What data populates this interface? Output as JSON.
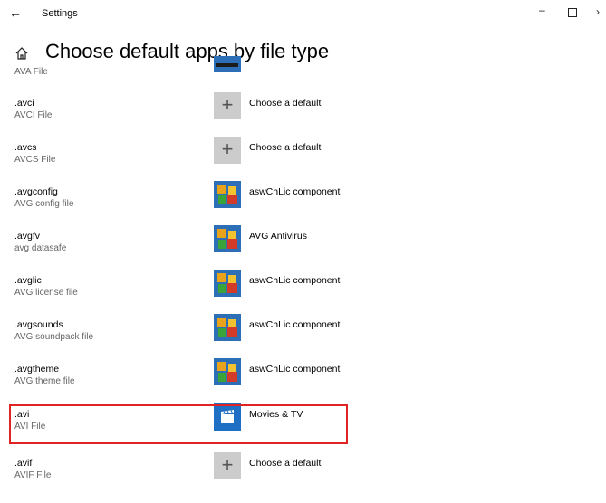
{
  "window": {
    "title": "Settings"
  },
  "header": {
    "title": "Choose default apps by file type"
  },
  "partial_row": {
    "description": "AVA File"
  },
  "rows": [
    {
      "ext": ".avci",
      "desc": "AVCI File",
      "app": "Choose a default",
      "icon": "plus-icon"
    },
    {
      "ext": ".avcs",
      "desc": "AVCS File",
      "app": "Choose a default",
      "icon": "plus-icon"
    },
    {
      "ext": ".avgconfig",
      "desc": "AVG config file",
      "app": "aswChLic component",
      "icon": "avg-icon"
    },
    {
      "ext": ".avgfv",
      "desc": "avg datasafe",
      "app": "AVG Antivirus",
      "icon": "avg-icon"
    },
    {
      "ext": ".avglic",
      "desc": "AVG license file",
      "app": "aswChLic component",
      "icon": "avg-icon"
    },
    {
      "ext": ".avgsounds",
      "desc": "AVG soundpack file",
      "app": "aswChLic component",
      "icon": "avg-icon"
    },
    {
      "ext": ".avgtheme",
      "desc": "AVG theme file",
      "app": "aswChLic component",
      "icon": "avg-icon"
    },
    {
      "ext": ".avi",
      "desc": "AVI File",
      "app": "Movies & TV",
      "icon": "movies-tv-icon"
    },
    {
      "ext": ".avif",
      "desc": "AVIF File",
      "app": "Choose a default",
      "icon": "plus-icon"
    }
  ],
  "colors": {
    "highlight": "#e02424",
    "avg_tile": "#2d6fb6",
    "movies_tile": "#1f6fc5",
    "plus_tile": "#cccccc"
  }
}
